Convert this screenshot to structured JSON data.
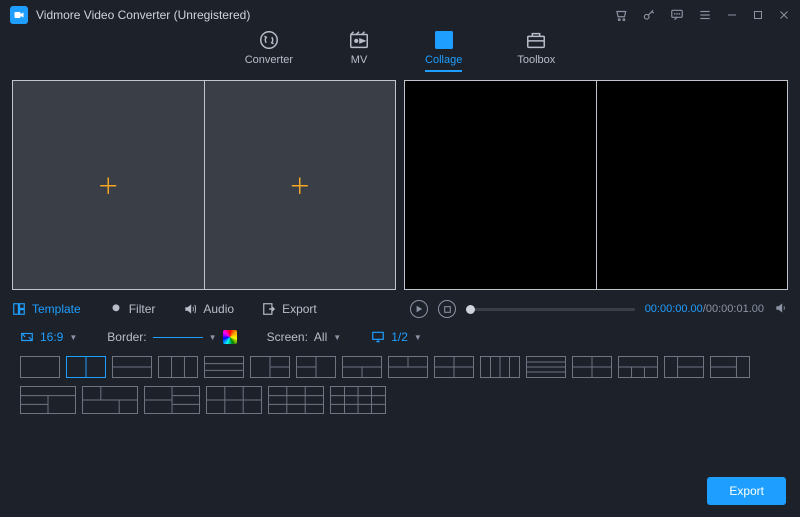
{
  "title": "Vidmore Video Converter (Unregistered)",
  "tabs": {
    "converter": "Converter",
    "mv": "MV",
    "collage": "Collage",
    "toolbox": "Toolbox"
  },
  "options": {
    "template": "Template",
    "filter": "Filter",
    "audio": "Audio",
    "export": "Export"
  },
  "playback": {
    "current": "00:00:00.00",
    "total": "00:00:01.00"
  },
  "ctrl": {
    "ratio": "16:9",
    "border_label": "Border:",
    "screen_label": "Screen:",
    "screen_value": "All",
    "fit_value": "1/2"
  },
  "export_button": "Export"
}
